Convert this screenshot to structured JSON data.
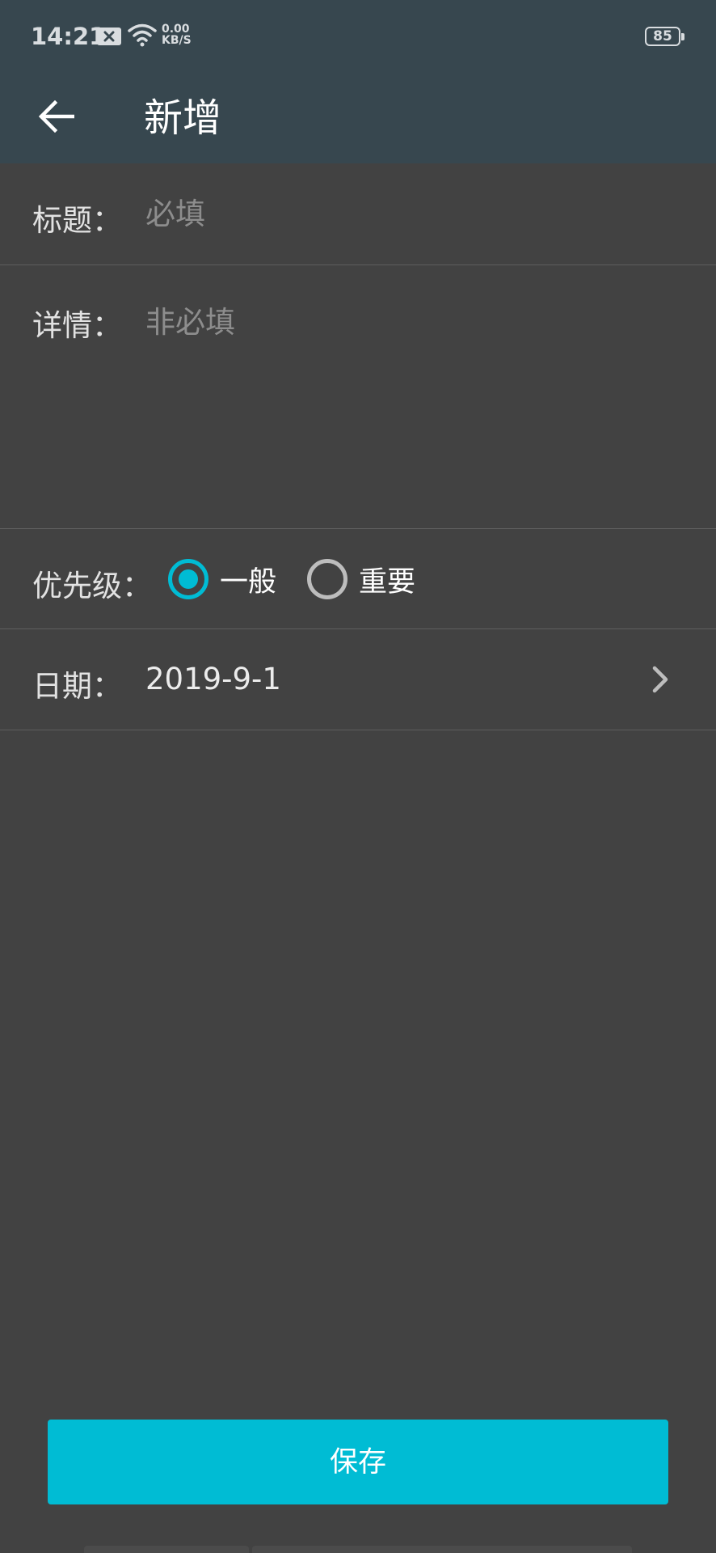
{
  "status_bar": {
    "time": "14:21",
    "net_speed_value": "0.00",
    "net_speed_unit": "KB/S",
    "battery": "85",
    "icons": [
      "notification-x-icon",
      "wifi-icon",
      "battery-icon"
    ]
  },
  "toolbar": {
    "back_icon": "arrow-left-icon",
    "title": "新增"
  },
  "form": {
    "title_label": "标题：",
    "title_placeholder": "必填",
    "title_value": "",
    "detail_label": "详情：",
    "detail_placeholder": "非必填",
    "detail_value": "",
    "priority_label": "优先级：",
    "priority_options": [
      {
        "label": "一般",
        "checked": true
      },
      {
        "label": "重要",
        "checked": false
      }
    ],
    "date_label": "日期：",
    "date_value": "2019-9-1",
    "date_icon": "chevron-right-icon"
  },
  "actions": {
    "save_label": "保存"
  },
  "colors": {
    "header_bg": "#37474f",
    "page_bg": "#424242",
    "accent": "#00bcd4"
  }
}
